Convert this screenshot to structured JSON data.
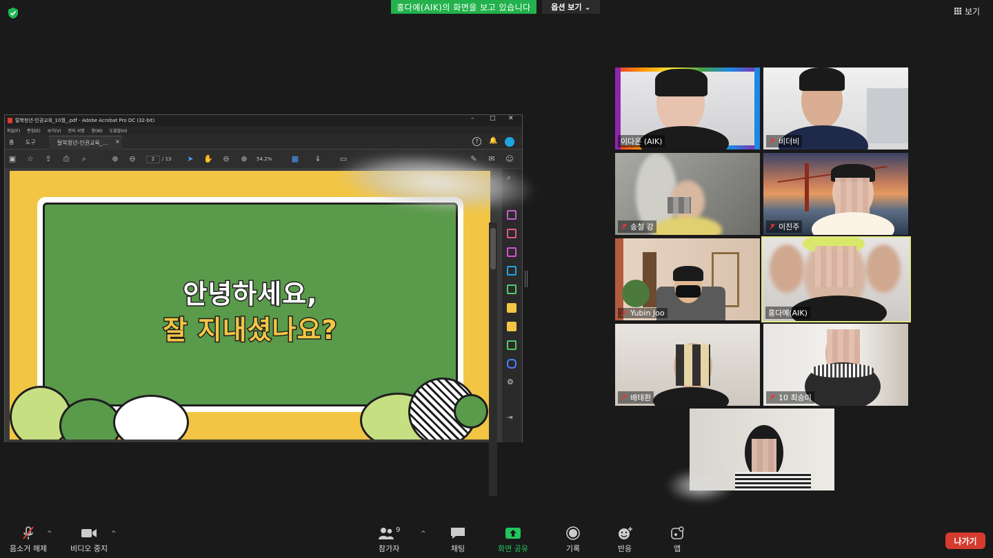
{
  "top": {
    "banner_text": "홍다예(AIK)의 화면을 보고 있습니다",
    "view_options_label": "옵션 보기",
    "view_label": "보기"
  },
  "acrobat": {
    "window_title": "탈북청년-인권교육_10월_.pdf - Adobe Acrobat Pro DC (32-bit)",
    "menu": [
      "파일(F)",
      "편집(E)",
      "보기(V)",
      "전자 서명",
      "창(W)",
      "도움말(H)"
    ],
    "tab_home": "홈",
    "tab_tools": "도구",
    "tab_doc": "탈북청년-인권교육_...",
    "page_current": "2",
    "page_total": "/ 13",
    "zoom": "54.2%",
    "slide_line1": "안녕하세요,",
    "slide_line2": "잘 지내셨나요?"
  },
  "participants": [
    {
      "name": "이다온 (AIK)",
      "muted": false
    },
    {
      "name": "비더비",
      "muted": true
    },
    {
      "name": "송철 강",
      "muted": true
    },
    {
      "name": "이진주",
      "muted": true
    },
    {
      "name": "Yubin Joo",
      "muted": true
    },
    {
      "name": "홍다예(AIK)",
      "muted": false
    },
    {
      "name": "배태환",
      "muted": true
    },
    {
      "name": "10 최승미",
      "muted": true
    },
    {
      "name": "",
      "muted": false
    }
  ],
  "bottom": {
    "unmute_label": "음소거 해제",
    "video_label": "비디오 중지",
    "participants_label": "참가자",
    "participants_count": "9",
    "chat_label": "채팅",
    "share_label": "화면 공유",
    "record_label": "기록",
    "reactions_label": "반응",
    "apps_label": "앱",
    "leave_label": "나가기"
  },
  "colors": {
    "share_green": "#22b14c",
    "leave_red": "#d63b2f",
    "active_speaker": "#e0e883",
    "slide_yellow": "#f2c545",
    "board_green": "#5a9a4b"
  }
}
